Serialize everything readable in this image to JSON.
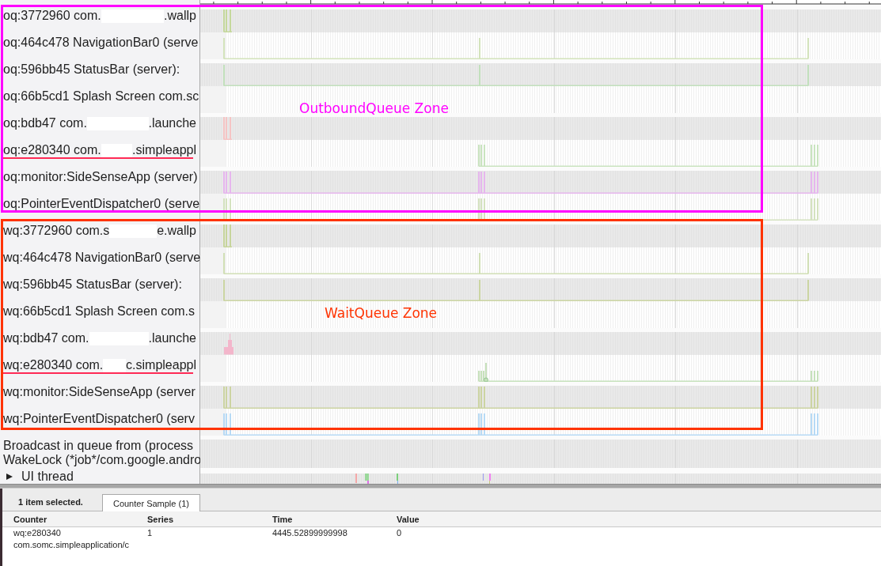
{
  "zones": [
    {
      "label": "OutboundQueue Zone",
      "color": "#ff00ff",
      "tracks": [
        {
          "label": "oq:3772960 com.",
          "redacted": true,
          "label_end": ".wallp",
          "underlined": false,
          "color": "#c5d89c"
        },
        {
          "label": "oq:464c478 NavigationBar0 (serve",
          "redacted": false,
          "underlined": false,
          "color": "#d3e3bb"
        },
        {
          "label": "oq:596bb45 StatusBar (server):",
          "redacted": false,
          "underlined": false,
          "color": "#c2e0bc"
        },
        {
          "label": "oq:66b5cd1 Splash Screen com.sc",
          "redacted": false,
          "underlined": false
        },
        {
          "label": "oq:bdb47 com.",
          "redacted": true,
          "label_end": ".launche",
          "underlined": false,
          "color": "#f5c4c4"
        },
        {
          "label": "oq:e280340 com.",
          "redacted": true,
          "label_end": ".simpleappl",
          "underlined": true,
          "color": "#c9e4bf"
        },
        {
          "label": "oq:monitor:SideSenseApp (server)",
          "redacted": false,
          "underlined": false,
          "color": "#e6b6ee"
        },
        {
          "label": "oq:PointerEventDispatcher0 (serve",
          "redacted": false,
          "underlined": false,
          "color": "#d4e2bf"
        }
      ]
    },
    {
      "label": "WaitQueue Zone",
      "color": "#ff3300",
      "tracks": [
        {
          "label": "wq:3772960 com.s",
          "redacted": true,
          "label_end": "e.wallp",
          "underlined": false,
          "color": "#c7d59c"
        },
        {
          "label": "wq:464c478 NavigationBar0 (serve",
          "redacted": false,
          "underlined": false,
          "color": "#d1dfb5"
        },
        {
          "label": "wq:596bb45 StatusBar (server):",
          "redacted": false,
          "underlined": false,
          "color": "#cbd5a2"
        },
        {
          "label": "wq:66b5cd1 Splash Screen com.s",
          "redacted": false,
          "underlined": false
        },
        {
          "label": "wq:bdb47 com.",
          "redacted": true,
          "label_end": ".launche",
          "underlined": false,
          "color": "#f3b6cb"
        },
        {
          "label": "wq:e280340 com.",
          "redacted": true,
          "label_end": "c.simpleappl",
          "underlined": true,
          "color": "#c6e1bb"
        },
        {
          "label": "wq:monitor:SideSenseApp (server",
          "redacted": false,
          "underlined": false,
          "color": "#ccd4a2"
        },
        {
          "label": "wq:PointerEventDispatcher0 (serv",
          "redacted": false,
          "underlined": false,
          "color": "#b7daf5"
        }
      ]
    }
  ],
  "other_tracks": [
    {
      "label": "Broadcast in queue from (process"
    },
    {
      "label": "WakeLock (*job*/com.google.andro"
    }
  ],
  "thread": {
    "label": "UI thread",
    "expanded": false
  },
  "details_panel": {
    "selection_summary": "1 item selected.",
    "tabs": [
      {
        "label": "Counter Sample (1)",
        "selected": true
      }
    ],
    "table": {
      "columns": [
        "Counter",
        "Series",
        "Time",
        "Value"
      ],
      "rows": [
        {
          "cells": [
            "wq:e280340 com.somc.simpleapplication/c",
            "1",
            "4445.52899999998",
            "0"
          ]
        }
      ]
    }
  }
}
